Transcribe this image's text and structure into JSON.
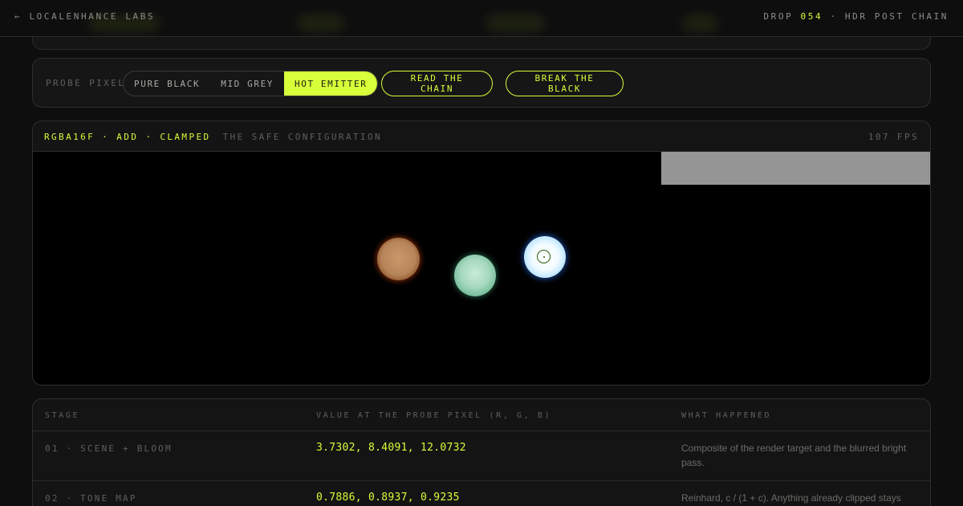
{
  "topbar": {
    "back_label": "← LOCALENHANCE LABS",
    "drop_prefix": "DROP",
    "drop_number": "054",
    "drop_suffix": "· HDR POST CHAIN"
  },
  "probe": {
    "label": "PROBE PIXEL",
    "options": [
      "PURE BLACK",
      "MID GREY",
      "HOT EMITTER"
    ],
    "selected": "HOT EMITTER",
    "read_button": "READ THE CHAIN",
    "break_button": "BREAK THE BLACK"
  },
  "viewport": {
    "config": "RGBA16F · ADD · CLAMPED",
    "config_subtitle": "THE SAFE CONFIGURATION",
    "fps": "107 FPS"
  },
  "table": {
    "headers": [
      "STAGE",
      "VALUE AT THE PROBE PIXEL (R, G, B)",
      "WHAT HAPPENED"
    ],
    "rows": [
      {
        "stage": "01 · SCENE + BLOOM",
        "value": "3.7302, 8.4091, 12.0732",
        "what": "Composite of the render target and the blurred bright pass."
      },
      {
        "stage": "02 · TONE MAP",
        "value": "0.7886, 0.8937, 0.9235",
        "what": "Reinhard, c / (1 + c). Anything already clipped stays"
      }
    ]
  },
  "colors": {
    "accent": "#d7ff3a",
    "background": "#0e0e0e",
    "panel": "#141414"
  }
}
